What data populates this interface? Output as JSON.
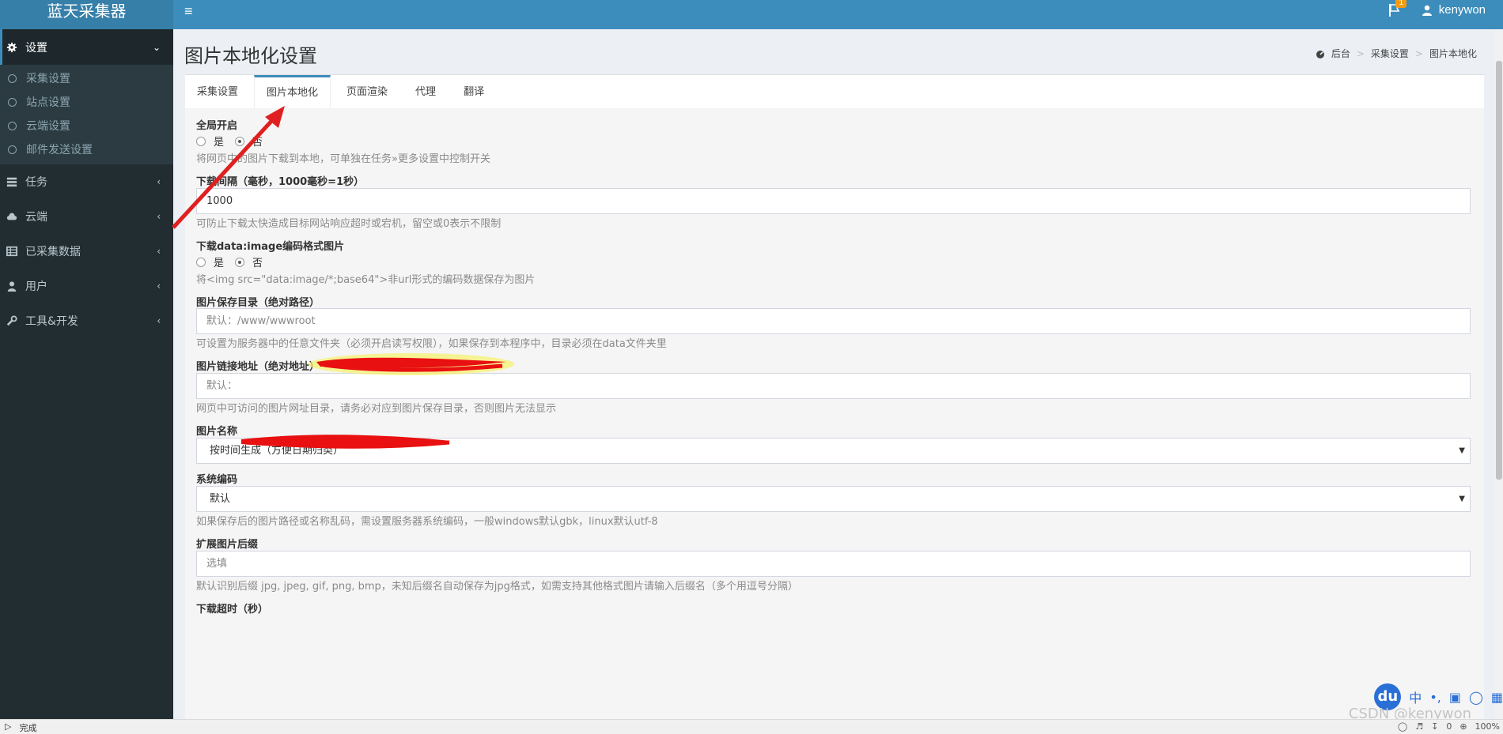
{
  "app": {
    "logo": "蓝天采集器"
  },
  "header": {
    "user_name": "kenywon",
    "notification_count": "1"
  },
  "sidebar": {
    "items": [
      {
        "label": "设置",
        "icon": "gear-icon",
        "expanded": true,
        "children": [
          "采集设置",
          "站点设置",
          "云端设置",
          "邮件发送设置"
        ]
      },
      {
        "label": "任务",
        "icon": "tasks-icon"
      },
      {
        "label": "云端",
        "icon": "cloud-icon"
      },
      {
        "label": "已采集数据",
        "icon": "database-icon"
      },
      {
        "label": "用户",
        "icon": "user-icon"
      },
      {
        "label": "工具&开发",
        "icon": "wrench-icon"
      }
    ]
  },
  "page": {
    "title": "图片本地化设置",
    "breadcrumb": [
      "后台",
      "采集设置",
      "图片本地化"
    ]
  },
  "tabs": [
    "采集设置",
    "图片本地化",
    "页面渲染",
    "代理",
    "翻译"
  ],
  "form": {
    "global_enable": {
      "label": "全局开启",
      "yes": "是",
      "no": "否",
      "selected": "否",
      "help": "将网页中的图片下载到本地，可单独在任务»更多设置中控制开关"
    },
    "interval": {
      "label": "下载间隔（毫秒，1000毫秒=1秒）",
      "value": "1000",
      "help": "可防止下载太快造成目标网站响应超时或宕机，留空或0表示不限制"
    },
    "data_image": {
      "label": "下载data:image编码格式图片",
      "yes": "是",
      "no": "否",
      "selected": "否",
      "help": "将<img src=\"data:image/*;base64\">非url形式的编码数据保存为图片"
    },
    "save_dir": {
      "label": "图片保存目录（绝对路径）",
      "placeholder": "默认：/www/wwwroot",
      "help": "可设置为服务器中的任意文件夹（必须开启读写权限），如果保存到本程序中，目录必须在data文件夹里"
    },
    "link_url": {
      "label": "图片链接地址（绝对地址）",
      "placeholder": "默认：",
      "help": "网页中可访问的图片网址目录，请务必对应到图片保存目录，否则图片无法显示"
    },
    "image_name": {
      "label": "图片名称",
      "selected": "按时间生成（方便日期归类）"
    },
    "encoding": {
      "label": "系统编码",
      "selected": "默认",
      "help": "如果保存后的图片路径或名称乱码，需设置服务器系统编码，一般windows默认gbk，linux默认utf-8"
    },
    "extension": {
      "label": "扩展图片后缀",
      "placeholder": "选填",
      "help": "默认识别后缀 jpg, jpeg, gif, png, bmp，未知后缀名自动保存为jpg格式，如需支持其他格式图片请输入后缀名（多个用逗号分隔）"
    },
    "timeout": {
      "label": "下载超时（秒）"
    }
  },
  "statusbar": {
    "left": "完成",
    "right_zoom": "100%",
    "right_count": "0"
  },
  "watermark": "CSDN @kenywon",
  "ime": {
    "logo": "du",
    "lang": "中"
  }
}
